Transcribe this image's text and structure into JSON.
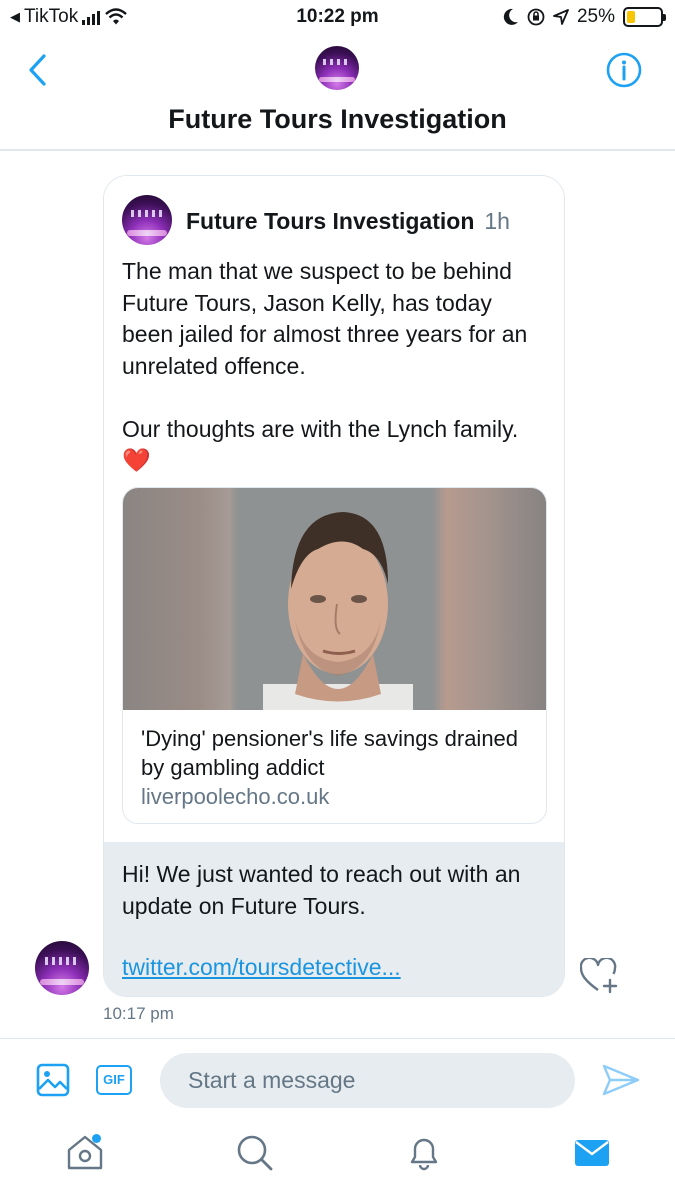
{
  "status_bar": {
    "back_app": "TikTok",
    "time": "10:22 pm",
    "battery": "25%",
    "battery_level": 0.25
  },
  "header": {
    "title": "Future Tours Investigation"
  },
  "tweet": {
    "author": "Future Tours Investigation",
    "age": "1h",
    "text": "The man that we suspect to be behind Future Tours, Jason Kelly, has today been jailed for almost three years for an unrelated offence.\n\nOur thoughts are with the Lynch family.",
    "emoji": "❤️",
    "link_card": {
      "title": "'Dying' pensioner's life savings drained by gambling addict",
      "domain": "liverpoolecho.co.uk"
    }
  },
  "message": {
    "text": "Hi! We just wanted to reach out with an update on Future Tours.",
    "link": "twitter.com/toursdetective...",
    "time": "10:17 pm"
  },
  "composer": {
    "placeholder": "Start a message",
    "gif_label": "GIF"
  },
  "icons": {
    "back": "chevron-left-icon",
    "info": "info-icon",
    "react": "heart-plus-icon",
    "image": "image-icon",
    "gif": "gif-icon",
    "send": "send-icon",
    "home": "home-icon",
    "search": "search-icon",
    "notifications": "bell-icon",
    "messages": "mail-icon"
  },
  "colors": {
    "accent": "#1da1f2",
    "link": "#1b95e0",
    "heart": "#e0245e",
    "bubble_bg": "#e6ecf0",
    "battery": "#f7c600"
  }
}
